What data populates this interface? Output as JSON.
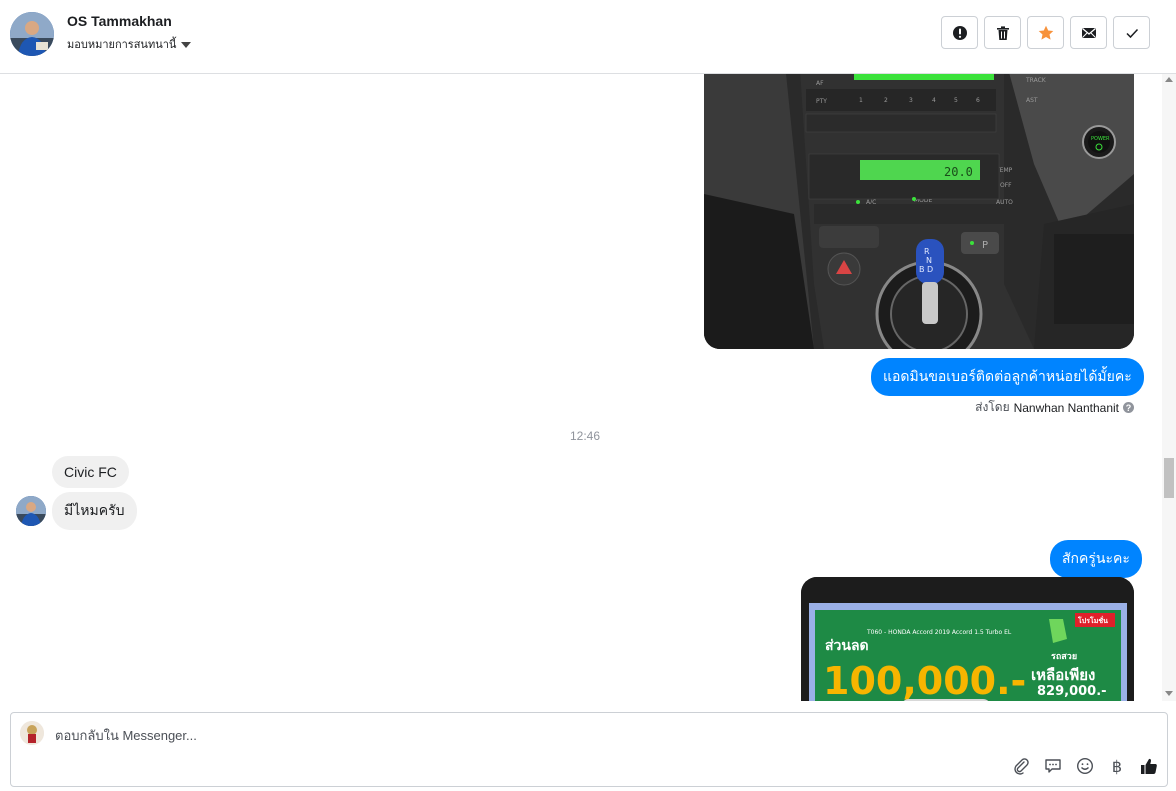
{
  "header": {
    "contact_name": "OS Tammakhan",
    "assign_label": "มอบหมายการสนทนานี้",
    "actions": [
      {
        "name": "mark-spam",
        "icon": "exclamation-circle-icon"
      },
      {
        "name": "delete",
        "icon": "trash-icon"
      },
      {
        "name": "star",
        "icon": "star-icon"
      },
      {
        "name": "mark-unread",
        "icon": "envelope-icon"
      },
      {
        "name": "mark-done",
        "icon": "checkmark-icon"
      }
    ]
  },
  "messages": {
    "outgoing_1": "แอดมินขอเบอร์ติดต่อลูกค้าหน่อยได้มั้ยคะ",
    "sent_by_prefix": "ส่งโดย",
    "sent_by_name": "Nanwhan Nanthanit",
    "timestamp": "12:46",
    "incoming_1": "Civic FC",
    "incoming_2": "มีไหมครับ",
    "outgoing_2": "สักครู่นะคะ"
  },
  "promo_image": {
    "badge": "โปรโมชั่น",
    "headline": "T060 - HONDA Accord 2019 Accord 1.5 Turbo EL",
    "discount_label": "ส่วนลด",
    "discount_amount": "100,000.-",
    "remaining_label": "เหลือเพียง",
    "price": "829,000.-",
    "brand": "รถสวย"
  },
  "composer": {
    "placeholder": "ตอบกลับใน Messenger...",
    "tools": [
      "paperclip-icon",
      "speech-bubble-icon",
      "smiley-icon",
      "baht-icon",
      "thumbs-up-icon"
    ],
    "baht_symbol": "฿"
  },
  "colors": {
    "accent": "#0084ff",
    "star": "#f7923b",
    "incoming_bubble": "#f0f0f0"
  }
}
